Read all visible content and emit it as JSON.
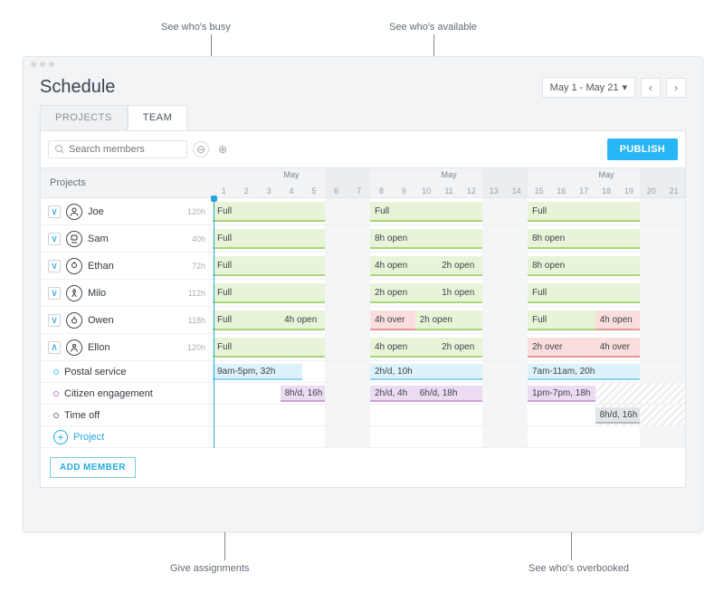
{
  "annotations": {
    "busy": "See who's busy",
    "available": "See who's available",
    "assign": "Give assignments",
    "overbooked": "See who's overbooked"
  },
  "header": {
    "title": "Schedule",
    "date_range": "May 1 - May 21"
  },
  "tabs": {
    "projects": "PROJECTS",
    "team": "TEAM"
  },
  "toolbar": {
    "search_placeholder": "Search members",
    "publish": "PUBLISH"
  },
  "calendar": {
    "projects_label": "Projects",
    "month_label": "May",
    "days": [
      1,
      2,
      3,
      4,
      5,
      6,
      7,
      8,
      9,
      10,
      11,
      12,
      13,
      14,
      15,
      16,
      17,
      18,
      19,
      20,
      21
    ],
    "month_positions": [
      4,
      11,
      18
    ]
  },
  "members": [
    {
      "name": "Joe",
      "hours": "120h",
      "expanded": false,
      "bars": [
        {
          "week": 0,
          "labels": [
            "Full"
          ],
          "style": "full",
          "span": [
            0,
            5
          ]
        },
        {
          "week": 1,
          "labels": [
            "Full"
          ],
          "style": "full",
          "span": [
            0,
            5
          ]
        },
        {
          "week": 2,
          "labels": [
            "Full"
          ],
          "style": "full",
          "span": [
            0,
            5
          ]
        }
      ]
    },
    {
      "name": "Sam",
      "hours": "40h",
      "expanded": false,
      "bars": [
        {
          "week": 0,
          "labels": [
            "Full"
          ],
          "style": "full",
          "span": [
            0,
            5
          ]
        },
        {
          "week": 1,
          "labels": [
            "8h open"
          ],
          "style": "full",
          "span": [
            0,
            5
          ]
        },
        {
          "week": 2,
          "labels": [
            "8h open"
          ],
          "style": "full",
          "span": [
            0,
            5
          ]
        }
      ]
    },
    {
      "name": "Ethan",
      "hours": "72h",
      "expanded": false,
      "bars": [
        {
          "week": 0,
          "labels": [
            "Full"
          ],
          "style": "full",
          "span": [
            0,
            5
          ]
        },
        {
          "week": 1,
          "labels": [
            "4h open",
            "2h open"
          ],
          "style": "full",
          "span": [
            0,
            5
          ]
        },
        {
          "week": 2,
          "labels": [
            "8h open"
          ],
          "style": "full",
          "span": [
            0,
            5
          ]
        }
      ]
    },
    {
      "name": "Milo",
      "hours": "112h",
      "expanded": false,
      "bars": [
        {
          "week": 0,
          "labels": [
            "Full"
          ],
          "style": "full",
          "span": [
            0,
            5
          ]
        },
        {
          "week": 1,
          "labels": [
            "2h open",
            "1h open"
          ],
          "style": "full",
          "span": [
            0,
            5
          ]
        },
        {
          "week": 2,
          "labels": [
            "Full"
          ],
          "style": "full",
          "span": [
            0,
            5
          ]
        }
      ]
    },
    {
      "name": "Owen",
      "hours": "118h",
      "expanded": false,
      "bars": [
        {
          "week": 0,
          "labels": [
            "Full",
            "4h open"
          ],
          "style": "full",
          "span": [
            0,
            5
          ]
        },
        {
          "week": 1,
          "labels": [
            "4h over"
          ],
          "style": "over",
          "span": [
            0,
            2
          ]
        },
        {
          "week": 1,
          "labels": [
            "2h open"
          ],
          "style": "full",
          "span": [
            2,
            5
          ]
        },
        {
          "week": 2,
          "labels": [
            "Full"
          ],
          "style": "full",
          "span": [
            0,
            3
          ]
        },
        {
          "week": 2,
          "labels": [
            "4h open"
          ],
          "style": "over",
          "span": [
            3,
            5
          ]
        }
      ]
    },
    {
      "name": "Ellon",
      "hours": "120h",
      "expanded": true,
      "bars": [
        {
          "week": 0,
          "labels": [
            "Full"
          ],
          "style": "full",
          "span": [
            0,
            5
          ]
        },
        {
          "week": 1,
          "labels": [
            "4h open",
            "2h open"
          ],
          "style": "full",
          "span": [
            0,
            5
          ]
        },
        {
          "week": 2,
          "labels": [
            "2h over"
          ],
          "style": "over",
          "span": [
            0,
            3
          ]
        },
        {
          "week": 2,
          "labels": [
            "4h over"
          ],
          "style": "over",
          "span": [
            3,
            5
          ]
        }
      ]
    }
  ],
  "subprojects": [
    {
      "name": "Postal service",
      "color": "#4fc8ee",
      "style": "blue",
      "bars": [
        {
          "week": 0,
          "labels": [
            "9am-5pm, 32h"
          ],
          "span": [
            0,
            4
          ]
        },
        {
          "week": 1,
          "labels": [
            "2h/d, 10h"
          ],
          "span": [
            0,
            5
          ]
        },
        {
          "week": 2,
          "labels": [
            "7am-11am, 20h"
          ],
          "span": [
            0,
            5
          ]
        }
      ]
    },
    {
      "name": "Citizen engagement",
      "color": "#b87fd0",
      "style": "violet",
      "bars": [
        {
          "week": 0,
          "labels": [
            "8h/d, 16h"
          ],
          "span": [
            3,
            5
          ]
        },
        {
          "week": 1,
          "labels": [
            "2h/d, 4h"
          ],
          "span": [
            0,
            2
          ]
        },
        {
          "week": 1,
          "labels": [
            "6h/d, 18h"
          ],
          "span": [
            2,
            5
          ]
        },
        {
          "week": 2,
          "labels": [
            "1pm-7pm, 18h"
          ],
          "span": [
            0,
            3
          ]
        }
      ]
    },
    {
      "name": "Time off",
      "color": "#777",
      "style": "gray",
      "bars": [
        {
          "week": 2,
          "labels": [
            "8h/d, 16h"
          ],
          "span": [
            3,
            5
          ]
        }
      ]
    }
  ],
  "add_project": "Project",
  "add_member": "ADD MEMBER"
}
